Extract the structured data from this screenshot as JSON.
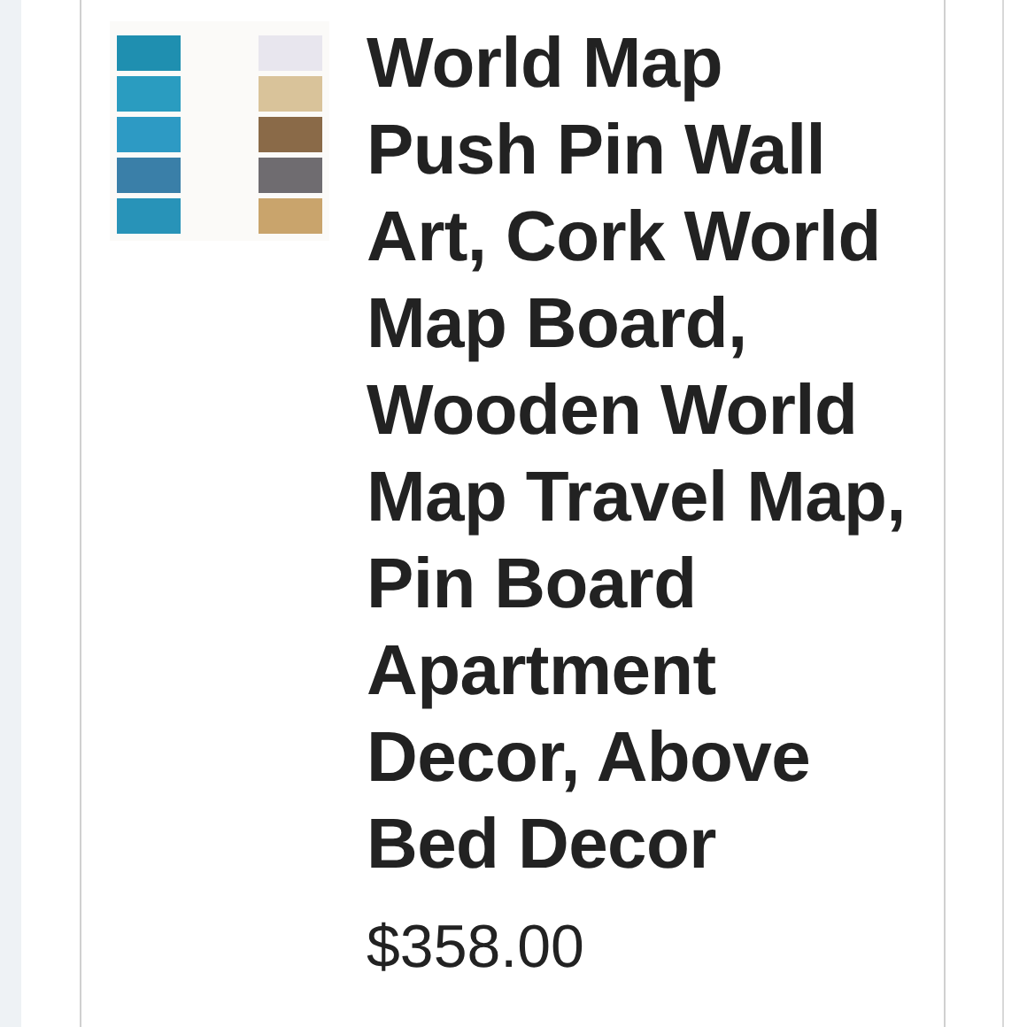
{
  "listing": {
    "title": "World Map Push Pin Wall Art, Cork World Map Board, Wooden World Map Travel Map, Pin Board Apartment Decor, Above Bed Decor",
    "price": "$358.00"
  }
}
